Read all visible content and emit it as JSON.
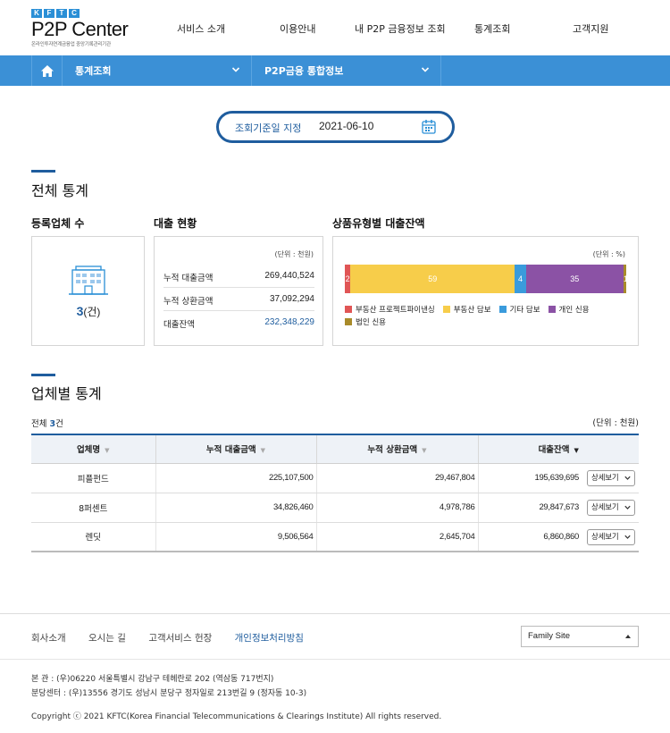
{
  "header": {
    "logo_letters": [
      "K",
      "F",
      "T",
      "C"
    ],
    "logo_main": "P2P Center",
    "logo_sub": "온라인투자연계금융업 중앙기록관리기관",
    "menu": [
      "서비스 소개",
      "이용안내",
      "내 P2P 금융정보 조회",
      "통계조회",
      "고객지원"
    ]
  },
  "navbar": {
    "home_icon": "home-icon",
    "item1": "통계조회",
    "item2": "P2P금융 통합정보"
  },
  "date_filter": {
    "label": "조회기준일 지정",
    "value": "2021-06-10",
    "icon": "calendar-icon"
  },
  "overall": {
    "title": "전체 통계",
    "registered": {
      "title": "등록업체 수",
      "count": "3",
      "unit": "(건)",
      "icon": "building-icon"
    },
    "loan_status": {
      "title": "대출 현황",
      "unit": "(단위 : 천원)",
      "rows": [
        {
          "label": "누적 대출금액",
          "value": "269,440,524"
        },
        {
          "label": "누적 상환금액",
          "value": "37,092,294"
        },
        {
          "label": "대출잔액",
          "value": "232,348,229"
        }
      ]
    },
    "product_balance": {
      "title": "상품유형별 대출잔액",
      "unit": "(단위 : %)"
    }
  },
  "chart_data": {
    "type": "bar",
    "orientation": "horizontal-stacked-100",
    "categories": [
      "부동산 프로젝트파이낸싱",
      "부동산 담보",
      "기타 담보",
      "개인 신용",
      "법인 신용"
    ],
    "values": [
      2,
      59,
      4,
      35,
      1
    ],
    "colors": [
      "#e05555",
      "#f7cd4a",
      "#3a9bdc",
      "#8b52a5",
      "#a98b2a"
    ],
    "legend": "bottom"
  },
  "company": {
    "title": "업체별 통계",
    "total_prefix": "전체 ",
    "total_count": "3",
    "total_suffix": "건",
    "unit": "(단위 : 천원)",
    "columns": [
      "업체명",
      "누적 대출금액",
      "누적 상환금액",
      "대출잔액"
    ],
    "detail_label": "상세보기",
    "rows": [
      {
        "name": "피플펀드",
        "loan": "225,107,500",
        "repay": "29,467,804",
        "balance": "195,639,695"
      },
      {
        "name": "8퍼센트",
        "loan": "34,826,460",
        "repay": "4,978,786",
        "balance": "29,847,673"
      },
      {
        "name": "렌딧",
        "loan": "9,506,564",
        "repay": "2,645,704",
        "balance": "6,860,860"
      }
    ]
  },
  "footer": {
    "links": [
      "회사소개",
      "오시는 길",
      "고객서비스 헌장",
      "개인정보처리방침"
    ],
    "family_site": "Family Site",
    "address1": "본 관 : (우)06220 서울특별시 강남구 테헤란로 202 (역삼동 717번지)",
    "address2": "분당센터 : (우)13556 경기도 성남시 분당구 정자일로 213번길 9 (정자동 10-3)",
    "copyright": "Copyright ⓒ 2021 KFTC(Korea Financial Telecommunications & Clearings Institute) All rights reserved."
  }
}
